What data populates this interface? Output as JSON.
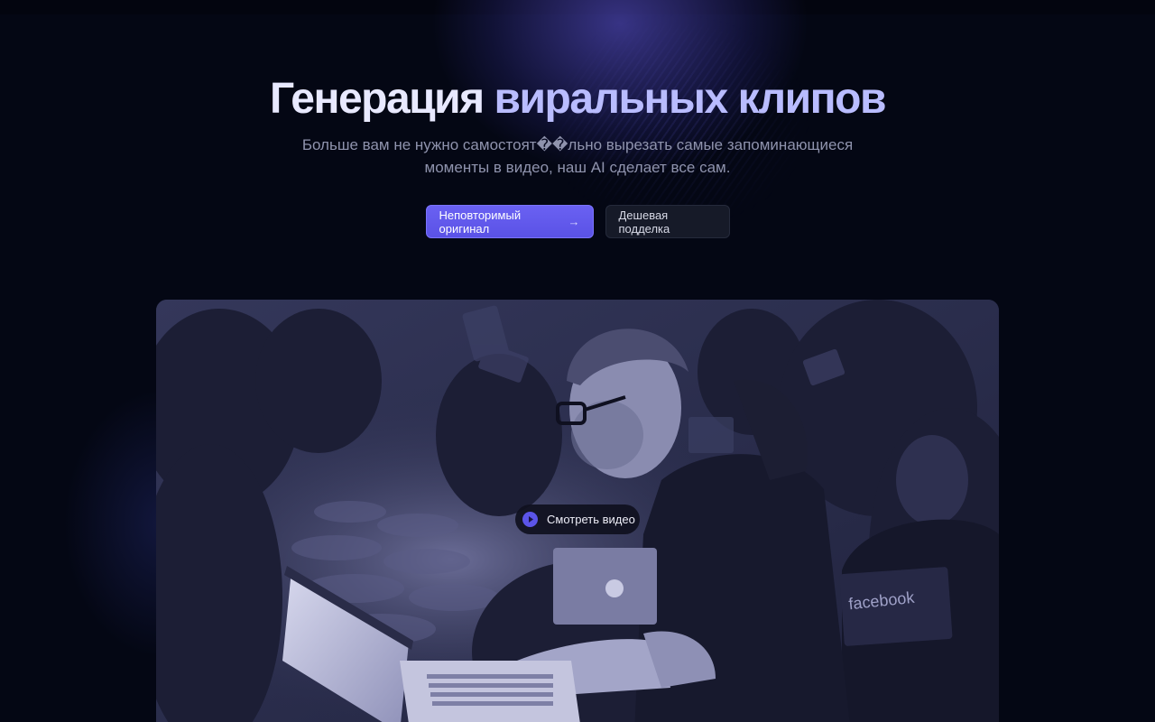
{
  "hero": {
    "title_part1": "Генерация ",
    "title_part2": "виральных клипов",
    "subtitle": "Больше вам не нужно самостоят��льно вырезать самые запоминающиеся моменты в видео, наш AI сделает все сам."
  },
  "actions": {
    "primary_label": "Неповторимый оригинал",
    "primary_arrow": "→",
    "secondary_label": "Дешевая подделка"
  },
  "video": {
    "watch_label": "Смотреть видео",
    "image_description_icon": "photo-people-laptops",
    "laptop_sticker_text": "facebook"
  },
  "colors": {
    "background": "#040714",
    "accent": "#5b54e8",
    "title_accent": "#b9bcff"
  }
}
